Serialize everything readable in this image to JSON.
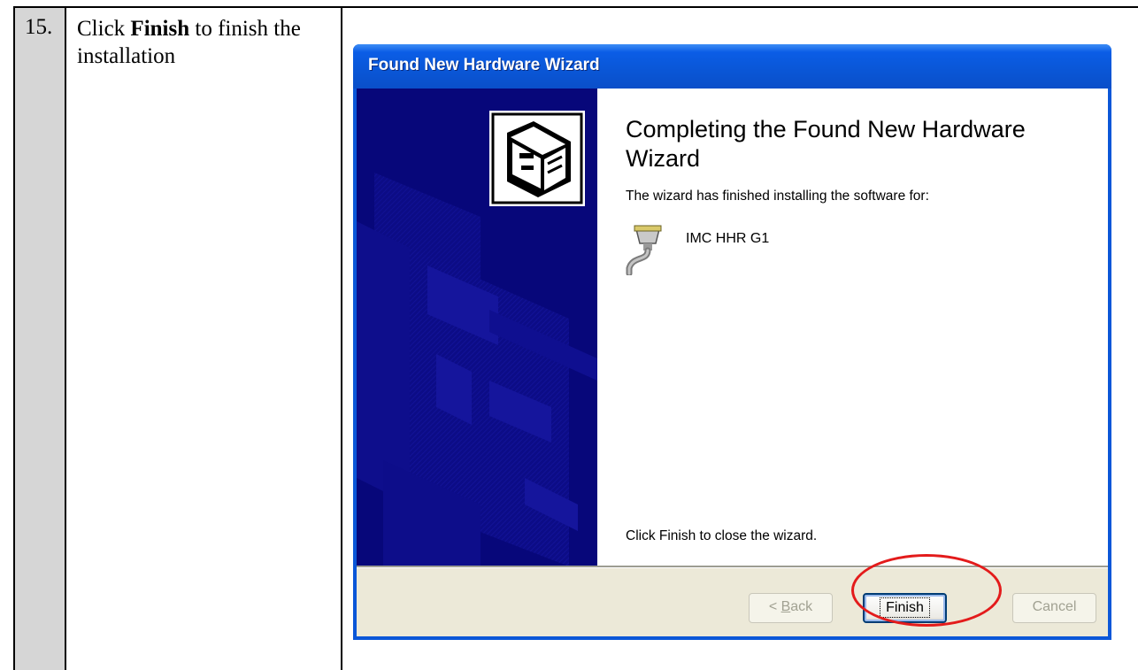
{
  "document": {
    "step_number": "15.",
    "instruction_prefix": "Click ",
    "instruction_bold": "Finish",
    "instruction_suffix": " to finish the installation"
  },
  "wizard": {
    "title": "Found New Hardware Wizard",
    "heading": "Completing the Found New Hardware Wizard",
    "description": "The wizard has finished installing the software for:",
    "device_icon": "serial-port-icon",
    "device_name": "IMC HHR G1",
    "close_hint": "Click Finish to close the wizard.",
    "hardware_icon": "hardware-box-icon",
    "buttons": {
      "back_prefix": "< ",
      "back_accel": "B",
      "back_rest": "ack",
      "finish": "Finish",
      "cancel": "Cancel"
    }
  },
  "colors": {
    "titlebar": "#0a56d6",
    "side_panel": "#07077a",
    "footer": "#ece9d8",
    "highlight": "#e31b1b"
  }
}
